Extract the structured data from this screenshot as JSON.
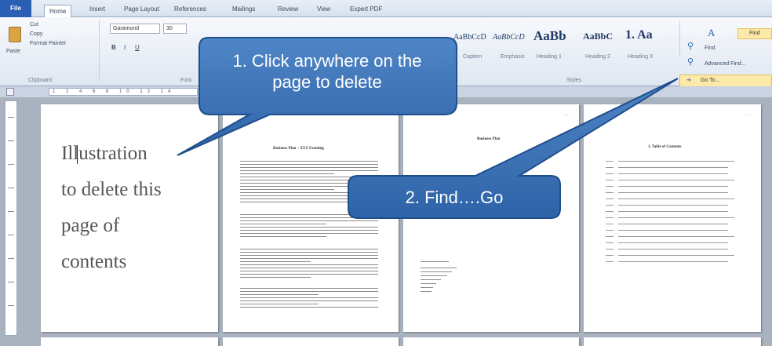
{
  "ribbon": {
    "tabs": [
      {
        "label": "File"
      },
      {
        "label": "Home"
      },
      {
        "label": "Insert"
      },
      {
        "label": "Page Layout"
      },
      {
        "label": "References"
      },
      {
        "label": "Mailings"
      },
      {
        "label": "Review"
      },
      {
        "label": "View"
      },
      {
        "label": "Expert PDF"
      }
    ],
    "clipboard": {
      "paste": "Paste",
      "cut": "Cut",
      "copy": "Copy",
      "format_painter": "Format Painter",
      "group": "Clipboard"
    },
    "font": {
      "name": "Garamond",
      "size": "30",
      "group": "Font"
    },
    "styles": {
      "group": "Styles",
      "items": [
        {
          "sample": "AaBbCcD",
          "name": "Caption"
        },
        {
          "sample": "AaBbCcD",
          "name": "Emphasis"
        },
        {
          "sample": "AaBb",
          "name": "Heading 1"
        },
        {
          "sample": "AaBbC",
          "name": "Heading 2"
        },
        {
          "sample": "1. Aa",
          "name": "Heading 3"
        }
      ]
    },
    "editing": {
      "find": "Find",
      "find_dropdown": "Find",
      "advanced_find": "Advanced Find...",
      "goto": "Go To..."
    }
  },
  "pages": {
    "page1": {
      "lines": [
        "Illustration",
        "to delete this",
        "page of",
        "contents"
      ]
    },
    "page2": {
      "title": "Business Plan – XYZ Farming"
    },
    "page3": {
      "title": "Business Plan"
    },
    "page4": {
      "title": "1.   Table of Contents"
    }
  },
  "callouts": {
    "first": "1. Click anywhere on the page to delete",
    "second": "2. Find….Go"
  }
}
